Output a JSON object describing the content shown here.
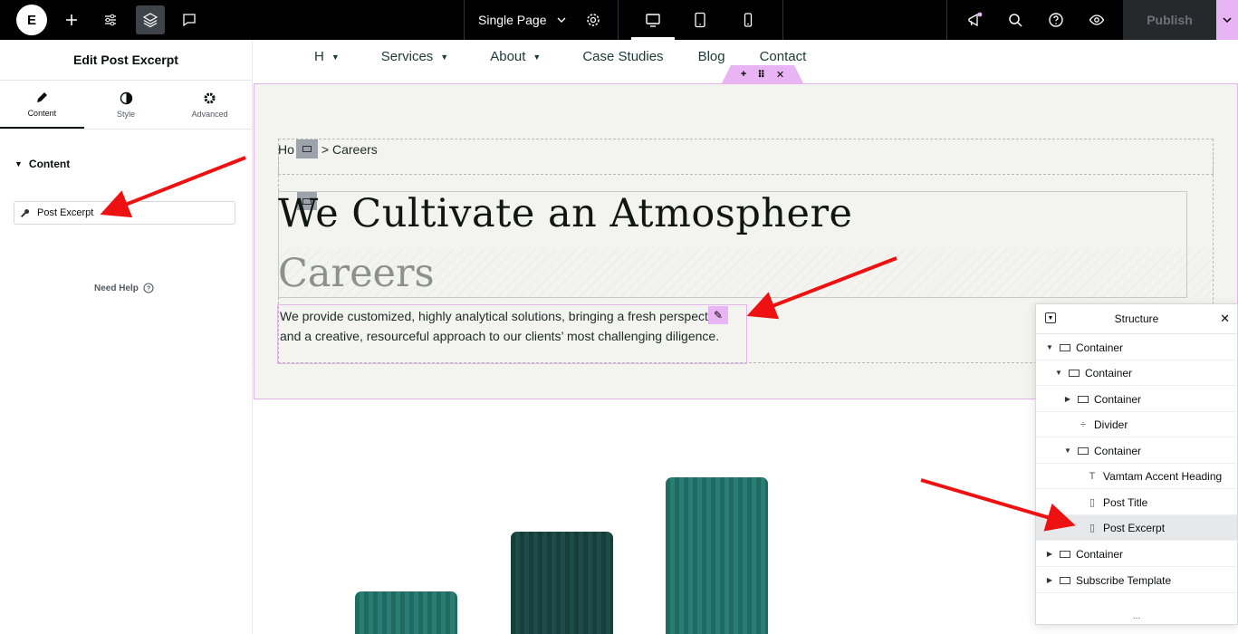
{
  "topbar": {
    "logo_glyph": "E",
    "page_selector": "Single Page",
    "publish": "Publish",
    "icons": [
      "plus-icon",
      "sliders-icon",
      "layers-icon",
      "chat-icon",
      "settings-icon",
      "desktop-icon",
      "tablet-icon",
      "mobile-icon",
      "megaphone-icon",
      "search-icon",
      "help-icon",
      "eye-icon"
    ]
  },
  "panel": {
    "title": "Edit Post Excerpt",
    "tabs": [
      {
        "label": "Content"
      },
      {
        "label": "Style"
      },
      {
        "label": "Advanced"
      }
    ],
    "section": "Content",
    "field_value": "Post Excerpt",
    "help": "Need Help"
  },
  "page": {
    "nav": [
      "H",
      "Services",
      "About",
      "Case Studies",
      "Blog",
      "Contact"
    ],
    "crumb_start": "Ho",
    "crumb_end": "> Careers",
    "heading": "We Cultivate an Atmosphere",
    "subheading": "Careers",
    "excerpt": "We provide customized, highly analytical solutions, bringing a fresh perspective and a creative, resourceful approach to our clients’ most challenging diligence."
  },
  "structure": {
    "title": "Structure",
    "items": [
      {
        "label": "Container",
        "level": 0,
        "toggle": "down",
        "icon": "container"
      },
      {
        "label": "Container",
        "level": 1,
        "toggle": "down",
        "icon": "container"
      },
      {
        "label": "Container",
        "level": 2,
        "toggle": "right",
        "icon": "container"
      },
      {
        "label": "Divider",
        "level": 2,
        "toggle": "",
        "icon": "divider"
      },
      {
        "label": "Container",
        "level": 2,
        "toggle": "down",
        "icon": "container"
      },
      {
        "label": "Vamtam Accent Heading",
        "level": 3,
        "toggle": "",
        "icon": "heading"
      },
      {
        "label": "Post Title",
        "level": 3,
        "toggle": "",
        "icon": "doc"
      },
      {
        "label": "Post Excerpt",
        "level": 3,
        "toggle": "",
        "icon": "doc",
        "selected": true
      },
      {
        "label": "Container",
        "level": 0,
        "toggle": "right",
        "icon": "container"
      },
      {
        "label": "Subscribe Template",
        "level": 0,
        "toggle": "right",
        "icon": "container"
      }
    ]
  },
  "colors": {
    "accent": "#e9b4f3",
    "arrow": "#ee1111",
    "bar": "#1f6b61"
  }
}
